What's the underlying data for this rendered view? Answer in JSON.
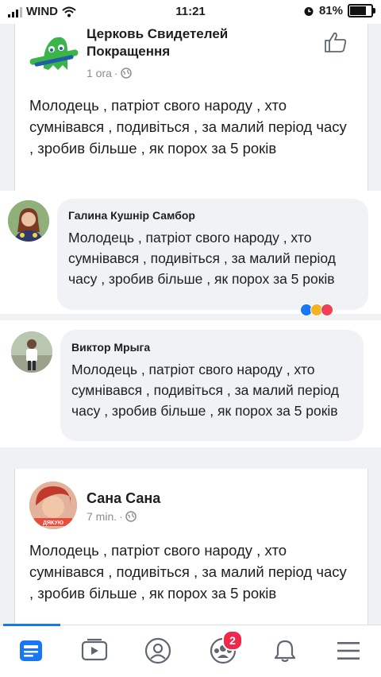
{
  "status_bar": {
    "carrier": "WIND",
    "time": "11:21",
    "battery": "81%",
    "battery_level": 0.81
  },
  "posts": [
    {
      "author": "Церковь Свидетелей Покращення",
      "time": "1 ora",
      "text": "Молодець , патріот свого народу , хто сумнівався , подивіться , за малий період часу , зробив більше , як порох за 5 років"
    },
    {
      "author": "Сана Сана",
      "time": "7 min.",
      "avatar_caption": "ДЯКУЮ",
      "text": "Молодець , патріот свого народу , хто сумнівався , подивіться , за малий період часу , зробив більше , як порох за 5 років"
    }
  ],
  "comments": [
    {
      "author": "Галина Кушнір Самбор",
      "text": "Молодець , патріот свого народу , хто сумнівався , подивіться , за малий період часу , зробив більше , як порох за 5 років"
    },
    {
      "author": "Виктор Мрыга",
      "text": "Молодець , патріот свого народу , хто сумнівався , подивіться , за малий період часу , зробив більше , як порох за 5 років"
    }
  ],
  "nav": {
    "items": [
      "news-feed-icon",
      "watch-icon",
      "profile-icon",
      "groups-icon",
      "notifications-icon",
      "menu-icon"
    ],
    "groups_badge": "2"
  },
  "colors": {
    "facebook_blue": "#1877f2",
    "bubble_bg": "#f0f2f5",
    "badge_red": "#f02849",
    "logo_green": "#3bb54a",
    "logo_blue": "#1f5fa8"
  }
}
